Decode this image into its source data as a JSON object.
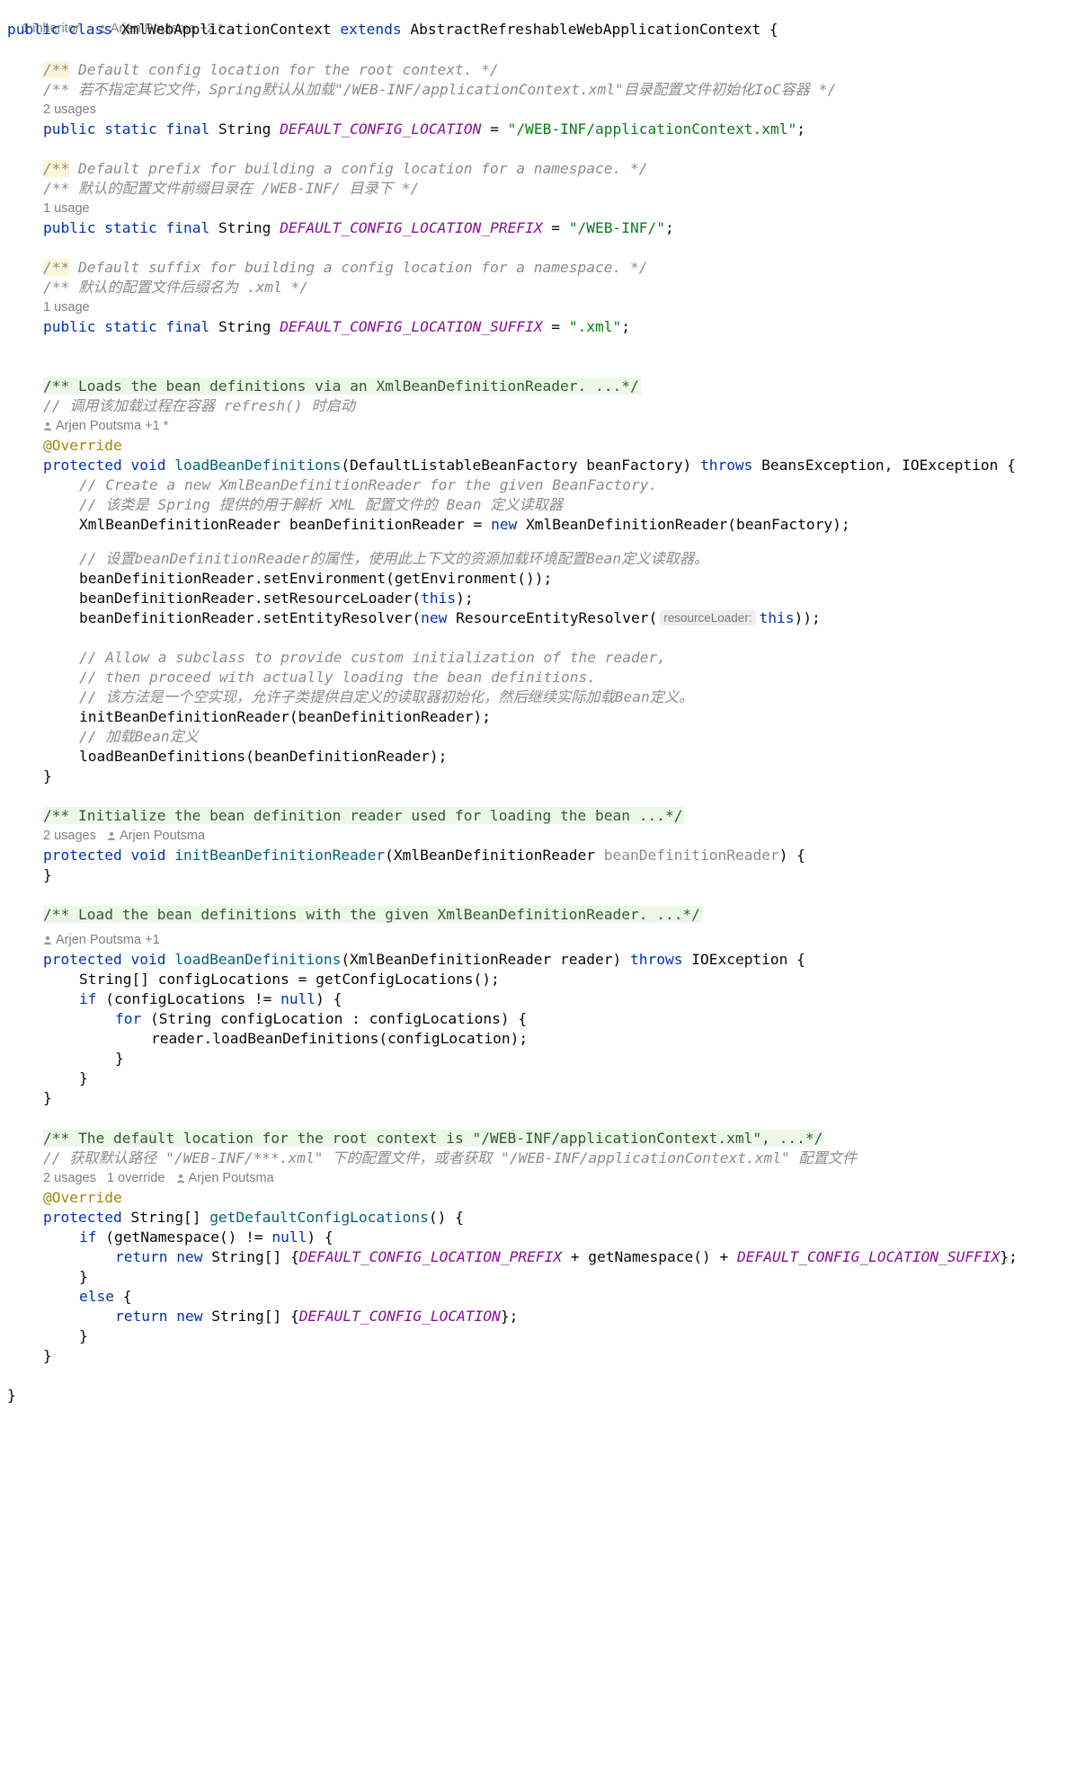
{
  "code": {
    "inheritors": "1 inheritor",
    "class_author": "Arjen Poutsma +2 *",
    "class_kw1": "public",
    "class_kw2": "class",
    "class_name": "XmlWebApplicationContext",
    "class_extends": "extends",
    "class_super": "AbstractRefreshableWebApplicationContext",
    "brace_open": " {",
    "brace_close": "}",
    "kw_public": "public",
    "kw_static": "static",
    "kw_final": "final",
    "kw_protected": "protected",
    "kw_void": "void",
    "kw_throws": "throws",
    "kw_new": "new",
    "kw_this": "this",
    "kw_if": "if",
    "kw_for": "for",
    "kw_null": "null",
    "kw_return": "return",
    "kw_else": "else",
    "type_string": "String",
    "override": "@Override",
    "f1": {
      "doc_mark": "/**",
      "doc_en": " Default config location for the root context. */",
      "doc_cn": "/** 若不指定其它文件，Spring默认从加载\"/WEB-INF/applicationContext.xml\"目录配置文件初始化IoC容器 */",
      "usages": "2 usages",
      "name": "DEFAULT_CONFIG_LOCATION",
      "value": "\"/WEB-INF/applicationContext.xml\""
    },
    "f2": {
      "doc_mark": "/**",
      "doc_en": " Default prefix for building a config location for a namespace. */",
      "doc_cn": "/** 默认的配置文件前缀目录在 /WEB-INF/ 目录下 */",
      "usages": "1 usage",
      "name": "DEFAULT_CONFIG_LOCATION_PREFIX",
      "value": "\"/WEB-INF/\""
    },
    "f3": {
      "doc_mark": "/**",
      "doc_en": " Default suffix for building a config location for a namespace. */",
      "doc_cn": "/** 默认的配置文件后缀名为 .xml */",
      "usages": "1 usage",
      "name": "DEFAULT_CONFIG_LOCATION_SUFFIX",
      "value": "\".xml\""
    },
    "m1": {
      "doc_fold": "/** Loads the bean definitions via an XmlBeanDefinitionReader. ...*/",
      "comment_cn": "// 调用该加载过程在容器 refresh() 时启动",
      "author": "Arjen Poutsma +1 *",
      "name": "loadBeanDefinitions",
      "params_open": "(DefaultListableBeanFactory beanFactory) ",
      "exceptions": " BeansException, IOException {",
      "c1": "// Create a new XmlBeanDefinitionReader for the given BeanFactory.",
      "c2": "// 该类是 Spring 提供的用于解析 XML 配置文件的 Bean 定义读取器",
      "s1a": "XmlBeanDefinitionReader beanDefinitionReader = ",
      "s1b": " XmlBeanDefinitionReader(beanFactory);",
      "c3": "// 设置beanDefinitionReader的属性，使用此上下文的资源加载环境配置Bean定义读取器。",
      "s2": "beanDefinitionReader.setEnvironment(getEnvironment());",
      "s3a": "beanDefinitionReader.setResourceLoader(",
      "s3b": ");",
      "s4a": "beanDefinitionReader.setEntityResolver(",
      "s4b": " ResourceEntityResolver(",
      "s4_hint": "resourceLoader:",
      "s4c": "));",
      "c4": "// Allow a subclass to provide custom initialization of the reader,",
      "c5": "// then proceed with actually loading the bean definitions.",
      "c6": "// 该方法是一个空实现，允许子类提供自定义的读取器初始化，然后继续实际加载Bean定义。",
      "s5": "initBeanDefinitionReader(beanDefinitionReader);",
      "c7": "// 加载Bean定义",
      "s6": "loadBeanDefinitions(beanDefinitionReader);"
    },
    "m2": {
      "doc_fold": "/** Initialize the bean definition reader used for loading the bean ...*/",
      "usages": "2 usages",
      "author": "Arjen Poutsma",
      "name": "initBeanDefinitionReader",
      "params": "(XmlBeanDefinitionReader ",
      "param_unused": "beanDefinitionReader",
      "params_close": ") {"
    },
    "m3": {
      "doc_fold": "/** Load the bean definitions with the given XmlBeanDefinitionReader. ...*/",
      "author": "Arjen Poutsma +1",
      "name": "loadBeanDefinitions",
      "params": "(XmlBeanDefinitionReader reader) ",
      "exceptions": " IOException {",
      "s1": "String[] configLocations = getConfigLocations();",
      "s2a": " (configLocations != ",
      "s2b": ") {",
      "s3": " (String configLocation : configLocations) {",
      "s4": "reader.loadBeanDefinitions(configLocation);"
    },
    "m4": {
      "doc_fold": "/** The default location for the root context is \"/WEB-INF/applicationContext.xml\", ...*/",
      "comment_cn": "// 获取默认路径 \"/WEB-INF/***.xml\" 下的配置文件，或者获取 \"/WEB-INF/applicationContext.xml\" 配置文件",
      "usages": "2 usages",
      "overrides": "1 override",
      "author": "Arjen Poutsma",
      "ret_type": "String[] ",
      "name": "getDefaultConfigLocations",
      "params": "() {",
      "s1a": " (getNamespace() != ",
      "s1b": ") {",
      "s2a": " String[] {",
      "s2_prefix": "DEFAULT_CONFIG_LOCATION_PREFIX",
      "s2_mid": " + getNamespace() + ",
      "s2_suffix": "DEFAULT_CONFIG_LOCATION_SUFFIX",
      "s2_end": "};",
      "s3_else": " {",
      "s4_const": "DEFAULT_CONFIG_LOCATION",
      "s4_end": "};"
    }
  }
}
